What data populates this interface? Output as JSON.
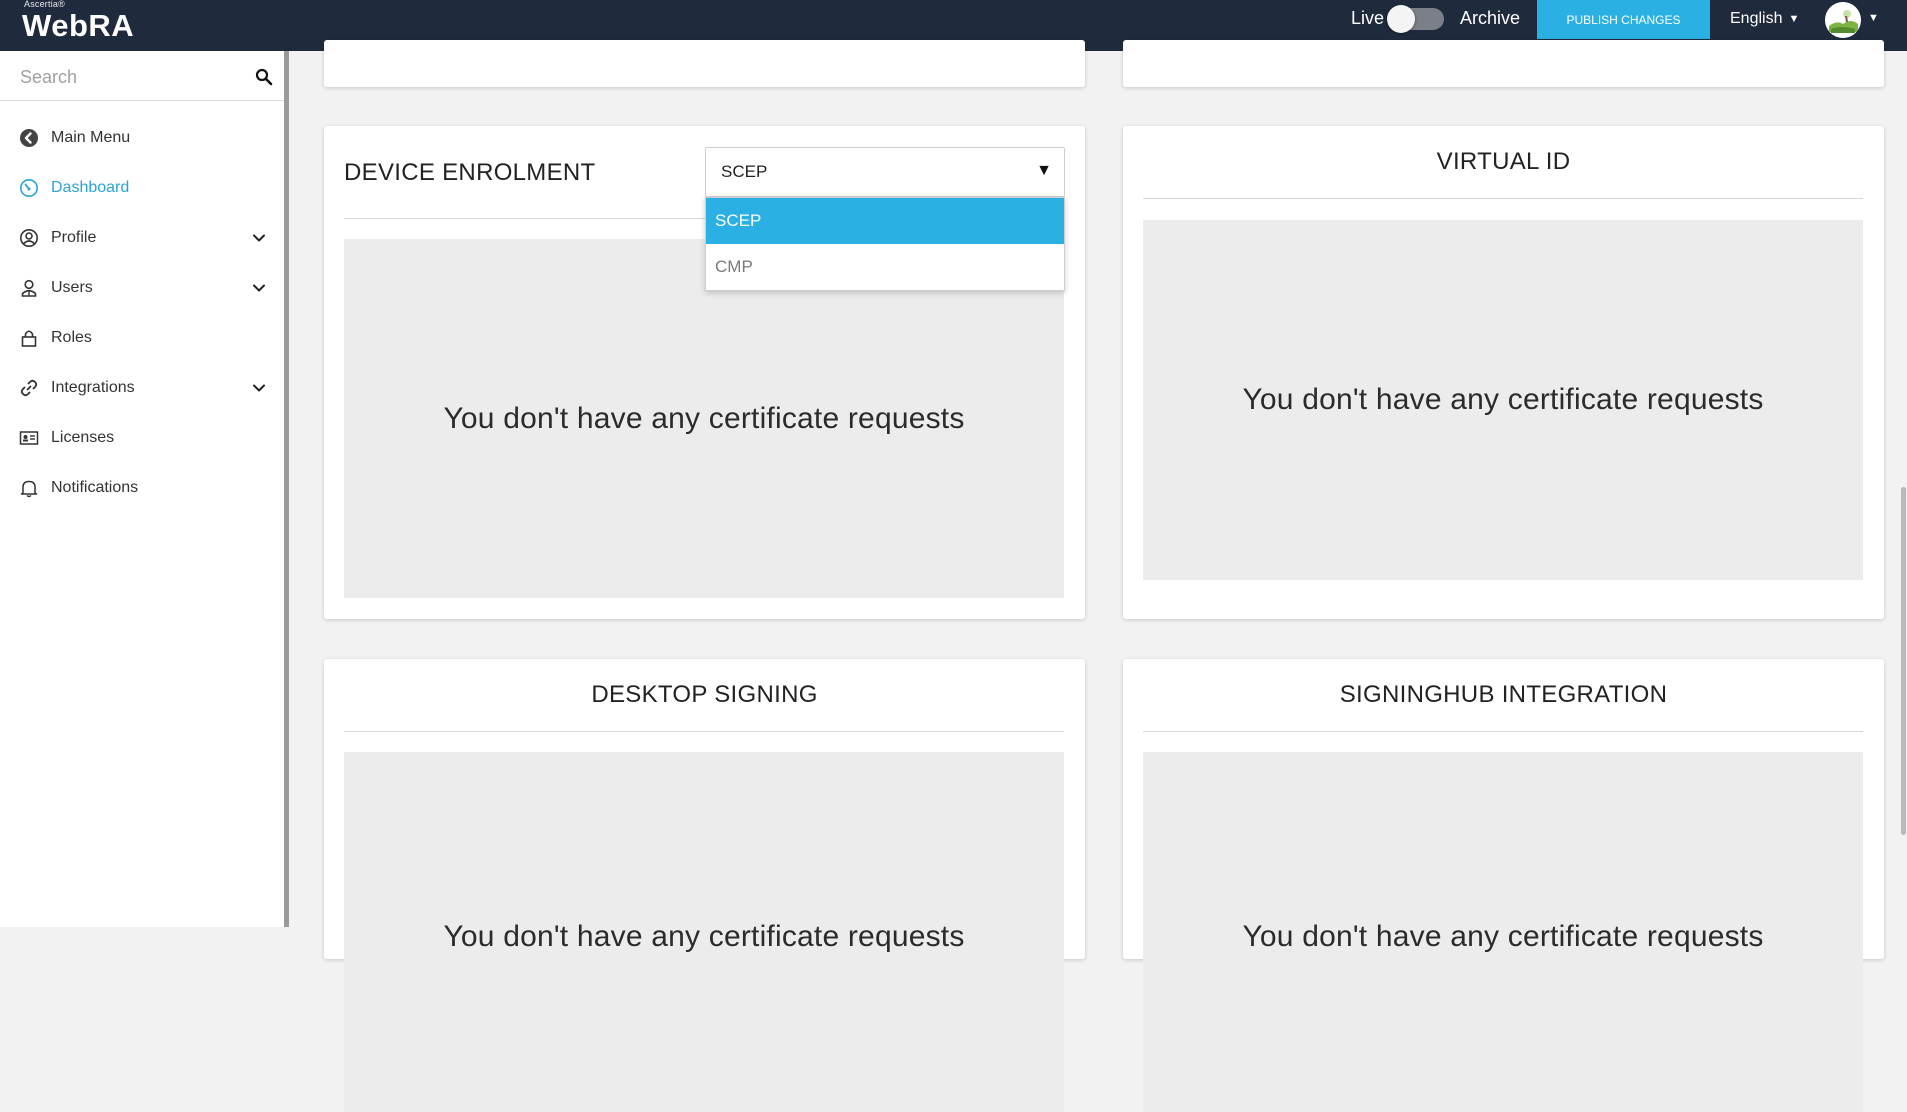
{
  "header": {
    "logo_sup": "Ascertia®",
    "logo_main": "WebRA",
    "live_label": "Live",
    "archive_label": "Archive",
    "publish_label": "PUBLISH CHANGES",
    "language": "English",
    "accent_color": "#2ab0e2",
    "bar_color": "#1f2b3c"
  },
  "sidebar": {
    "search_placeholder": "Search",
    "items": [
      {
        "label": "Main Menu",
        "icon": "back-circle-icon",
        "active": false,
        "expandable": false
      },
      {
        "label": "Dashboard",
        "icon": "speedometer-icon",
        "active": true,
        "expandable": false
      },
      {
        "label": "Profile",
        "icon": "user-circle-icon",
        "active": false,
        "expandable": true
      },
      {
        "label": "Users",
        "icon": "user-icon",
        "active": false,
        "expandable": true
      },
      {
        "label": "Roles",
        "icon": "lock-icon",
        "active": false,
        "expandable": false
      },
      {
        "label": "Integrations",
        "icon": "link-icon",
        "active": false,
        "expandable": true
      },
      {
        "label": "Licenses",
        "icon": "id-card-icon",
        "active": false,
        "expandable": false
      },
      {
        "label": "Notifications",
        "icon": "bell-icon",
        "active": false,
        "expandable": false
      }
    ]
  },
  "cards": {
    "device_enrolment": {
      "title": "DEVICE ENROLMENT",
      "select_value": "SCEP",
      "options": [
        "SCEP",
        "CMP"
      ],
      "empty_text": "You don't have any certificate requests"
    },
    "virtual_id": {
      "title": "VIRTUAL ID",
      "empty_text": "You don't have any certificate requests"
    },
    "desktop_signing": {
      "title": "DESKTOP SIGNING",
      "empty_text": "You don't have any certificate requests"
    },
    "signinghub_integration": {
      "title": "SIGNINGHUB INTEGRATION",
      "empty_text": "You don't have any certificate requests"
    }
  }
}
